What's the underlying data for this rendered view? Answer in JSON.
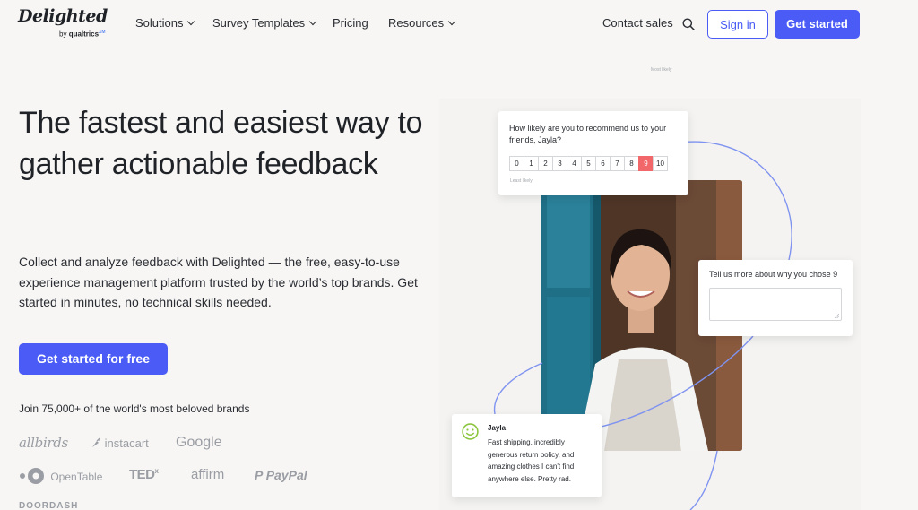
{
  "nav": {
    "logo_word": "Delighted",
    "logo_by": "by",
    "logo_brand": "qualtrics",
    "logo_mark": "XM",
    "items": [
      {
        "label": "Solutions",
        "has_menu": true
      },
      {
        "label": "Survey Templates",
        "has_menu": true
      },
      {
        "label": "Pricing",
        "has_menu": false
      },
      {
        "label": "Resources",
        "has_menu": true
      }
    ],
    "contact_sales": "Contact sales",
    "search_icon": "search-icon",
    "sign_in": "Sign in",
    "get_started": "Get started"
  },
  "hero": {
    "headline": "The fastest and easiest way to gather actionable feedback",
    "subtext": "Collect and analyze feedback with Delighted — the free, easy-to-use experience management platform trusted by the world’s top brands. Get started in minutes, no technical skills needed.",
    "cta": "Get started for free",
    "brands_title": "Join 75,000+ of the world's most beloved brands",
    "brands": [
      "allbirds",
      "instacart",
      "Google",
      "OpenTable",
      "TED",
      "affirm",
      "PayPal",
      "DOORDASH"
    ]
  },
  "survey": {
    "question": "How likely are you to recommend us to your friends, Jayla?",
    "scale": [
      "0",
      "1",
      "2",
      "3",
      "4",
      "5",
      "6",
      "7",
      "8",
      "9",
      "10"
    ],
    "selected": "9",
    "least": "Least likely",
    "most": "Most likely",
    "followup": "Tell us more about why you chose 9"
  },
  "review": {
    "name": "Jayla",
    "text": "Fast shipping, incredibly generous return policy, and amazing clothes I can't find anywhere else. Pretty rad."
  },
  "colors": {
    "accent": "#4a5cf5",
    "selected_score": "#f2676a",
    "background": "#f7f6f4",
    "ring": "#7f93f0",
    "smile": "#8cc63f"
  }
}
